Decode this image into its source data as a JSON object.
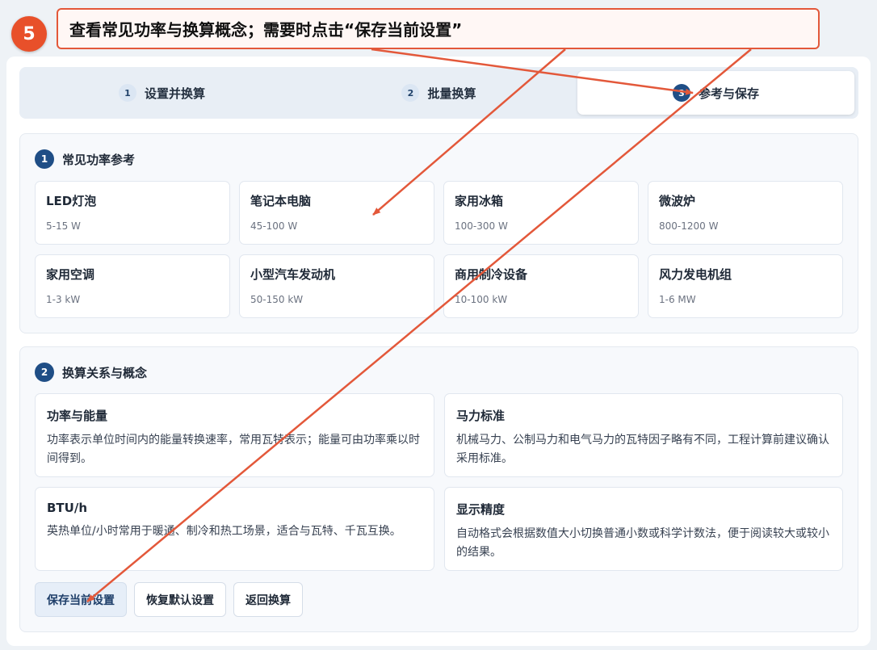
{
  "annotation": {
    "step": "5",
    "instruction": "查看常见功率与换算概念；需要时点击“保存当前设置”",
    "color": "#e3583a"
  },
  "tabs": [
    {
      "num": "1",
      "label": "设置并换算",
      "active": false
    },
    {
      "num": "2",
      "label": "批量换算",
      "active": false
    },
    {
      "num": "3",
      "label": "参考与保存",
      "active": true
    }
  ],
  "reference": {
    "num": "1",
    "title": "常见功率参考",
    "items": [
      {
        "name": "LED灯泡",
        "range": "5-15 W"
      },
      {
        "name": "笔记本电脑",
        "range": "45-100 W"
      },
      {
        "name": "家用冰箱",
        "range": "100-300 W"
      },
      {
        "name": "微波炉",
        "range": "800-1200 W"
      },
      {
        "name": "家用空调",
        "range": "1-3 kW"
      },
      {
        "name": "小型汽车发动机",
        "range": "50-150 kW"
      },
      {
        "name": "商用制冷设备",
        "range": "10-100 kW"
      },
      {
        "name": "风力发电机组",
        "range": "1-6 MW"
      }
    ]
  },
  "concepts": {
    "num": "2",
    "title": "换算关系与概念",
    "items": [
      {
        "title": "功率与能量",
        "text": "功率表示单位时间内的能量转换速率，常用瓦特表示；能量可由功率乘以时间得到。"
      },
      {
        "title": "马力标准",
        "text": "机械马力、公制马力和电气马力的瓦特因子略有不同，工程计算前建议确认采用标准。"
      },
      {
        "title": "BTU/h",
        "text": "英热单位/小时常用于暖通、制冷和热工场景，适合与瓦特、千瓦互换。"
      },
      {
        "title": "显示精度",
        "text": "自动格式会根据数值大小切换普通小数或科学计数法，便于阅读较大或较小的结果。"
      }
    ]
  },
  "actions": {
    "save": "保存当前设置",
    "reset": "恢复默认设置",
    "back": "返回换算"
  },
  "colors": {
    "accent": "#1f4e86",
    "annotation_red": "#e3583a",
    "background": "#eef2f6"
  }
}
